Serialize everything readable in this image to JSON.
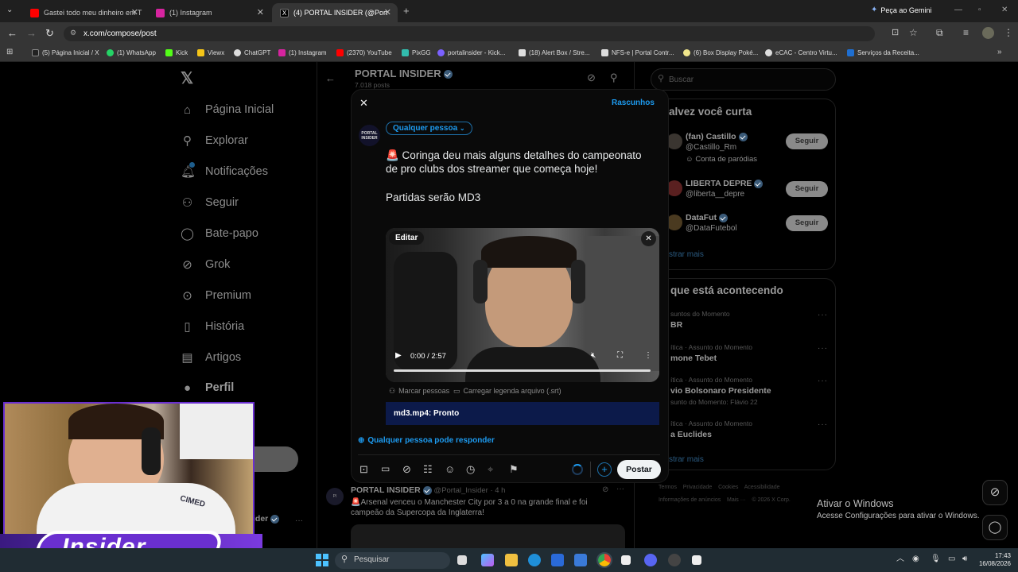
{
  "tabs": [
    {
      "label": "Gastei todo meu dinheiro em T"
    },
    {
      "label": "(1) Instagram"
    },
    {
      "label": "(4) PORTAL INSIDER (@Portal_I"
    }
  ],
  "gemini": "Peça ao Gemini",
  "url": "x.com/compose/post",
  "bookmarks": [
    {
      "label": "(5) Página Inicial / X",
      "color": "#222"
    },
    {
      "label": "(1) WhatsApp",
      "color": "#25d366"
    },
    {
      "label": "Kick",
      "color": "#53fc18"
    },
    {
      "label": "Viewx",
      "color": "#f5c518"
    },
    {
      "label": "ChatGPT",
      "color": "#ddd"
    },
    {
      "label": "(1) Instagram",
      "color": "#d6249f"
    },
    {
      "label": "(2370) YouTube",
      "color": "#ff0000"
    },
    {
      "label": "PixGG",
      "color": "#32bcad"
    },
    {
      "label": "portalinsider - Kick...",
      "color": "#7b61ff"
    },
    {
      "label": "(18) Alert Box / Stre...",
      "color": "#ddd"
    },
    {
      "label": "NFS-e | Portal Contr...",
      "color": "#ddd"
    },
    {
      "label": "(6) Box Display Poké...",
      "color": "#f0e68c"
    },
    {
      "label": "eCAC - Centro Virtu...",
      "color": "#ddd"
    },
    {
      "label": "Serviços da Receita...",
      "color": "#1f6fd1"
    }
  ],
  "nav": [
    {
      "label": "Página Inicial",
      "icon": "home-icon",
      "glyph": "⌂"
    },
    {
      "label": "Explorar",
      "icon": "search-icon",
      "glyph": "⚲"
    },
    {
      "label": "Notificações",
      "icon": "bell-icon",
      "glyph": "♫"
    },
    {
      "label": "Seguir",
      "icon": "person-plus-icon",
      "glyph": "⚇"
    },
    {
      "label": "Bate-papo",
      "icon": "chat-icon",
      "glyph": "◯"
    },
    {
      "label": "Grok",
      "icon": "grok-icon",
      "glyph": "⊘"
    },
    {
      "label": "Premium",
      "icon": "premium-icon",
      "glyph": "⊙"
    },
    {
      "label": "História",
      "icon": "bookmark-icon",
      "glyph": "▯"
    },
    {
      "label": "Artigos",
      "icon": "articles-icon",
      "glyph": "▤"
    },
    {
      "label": "Perfil",
      "icon": "profile-icon",
      "glyph": "●"
    }
  ],
  "profile": {
    "name": "PORTAL INSIDER",
    "posts": "7.018 posts"
  },
  "compose": {
    "drafts": "Rascunhos",
    "audience": "Qualquer pessoa",
    "avatar_text": "PORTAL INSIDER",
    "text_line1": "🚨 Coringa deu mais alguns detalhes do campeonato",
    "text_line2": "de pro clubs dos streamer que começa hoje!",
    "text_line3": "Partidas serão MD3",
    "edit": "Editar",
    "video_time": "0:00 / 2:57",
    "tag_people": "Marcar pessoas",
    "caption_file": "Carregar legenda arquivo (.srt)",
    "upload_status": "md3.mp4: Pronto",
    "reply_setting": "Qualquer pessoa pode responder",
    "post_button": "Postar"
  },
  "feed_post": {
    "name": "PORTAL INSIDER",
    "handle": "@Portal_Insider · 4 h",
    "text_line1": "🚨Arsenal venceu o Manchester City por 3 a 0 na grande final e foi",
    "text_line2": "campeão da Supercopa da Inglaterra!"
  },
  "search_placeholder": "Buscar",
  "who_to_follow": {
    "title": "alvez você curta",
    "follow_label": "Seguir",
    "show_more": "strar mais",
    "users": [
      {
        "name": "(fan) Castillo",
        "handle": "@Castillo_Rm",
        "note": "Conta de paródias"
      },
      {
        "name": "LIBERTA DEPRE",
        "handle": "@liberta__depre",
        "note": ""
      },
      {
        "name": "DataFut",
        "handle": "@DataFutebol",
        "note": ""
      }
    ]
  },
  "trending": {
    "title": "que está acontecendo",
    "show_more": "strar mais",
    "items": [
      {
        "context": "suntos do Momento",
        "name": "BR",
        "extra": ""
      },
      {
        "context": "ítica · Assunto do Momento",
        "name": "mone Tebet",
        "extra": ""
      },
      {
        "context": "ítica · Assunto do Momento",
        "name": "vio Bolsonaro Presidente",
        "extra": "sunto do Momento: Flávio 22"
      },
      {
        "context": "ítica · Assunto do Momento",
        "name": "a Euclides",
        "extra": ""
      }
    ]
  },
  "footer_links": {
    "line1": "Termos    Privacidade    Cookies    Acessibilidade",
    "line2": "Informações de anúncios    Mais ···    © 2026 X Corp."
  },
  "windows_activation": {
    "title": "Ativar o Windows",
    "subtitle": "Acesse Configurações para ativar o Windows."
  },
  "webcam_overlay": "Insider",
  "webcam_shirt": "CIMED",
  "side_user": {
    "name": "ider"
  },
  "taskbar": {
    "search": "Pesquisar",
    "time": "17:43",
    "date": "16/08/2026"
  }
}
